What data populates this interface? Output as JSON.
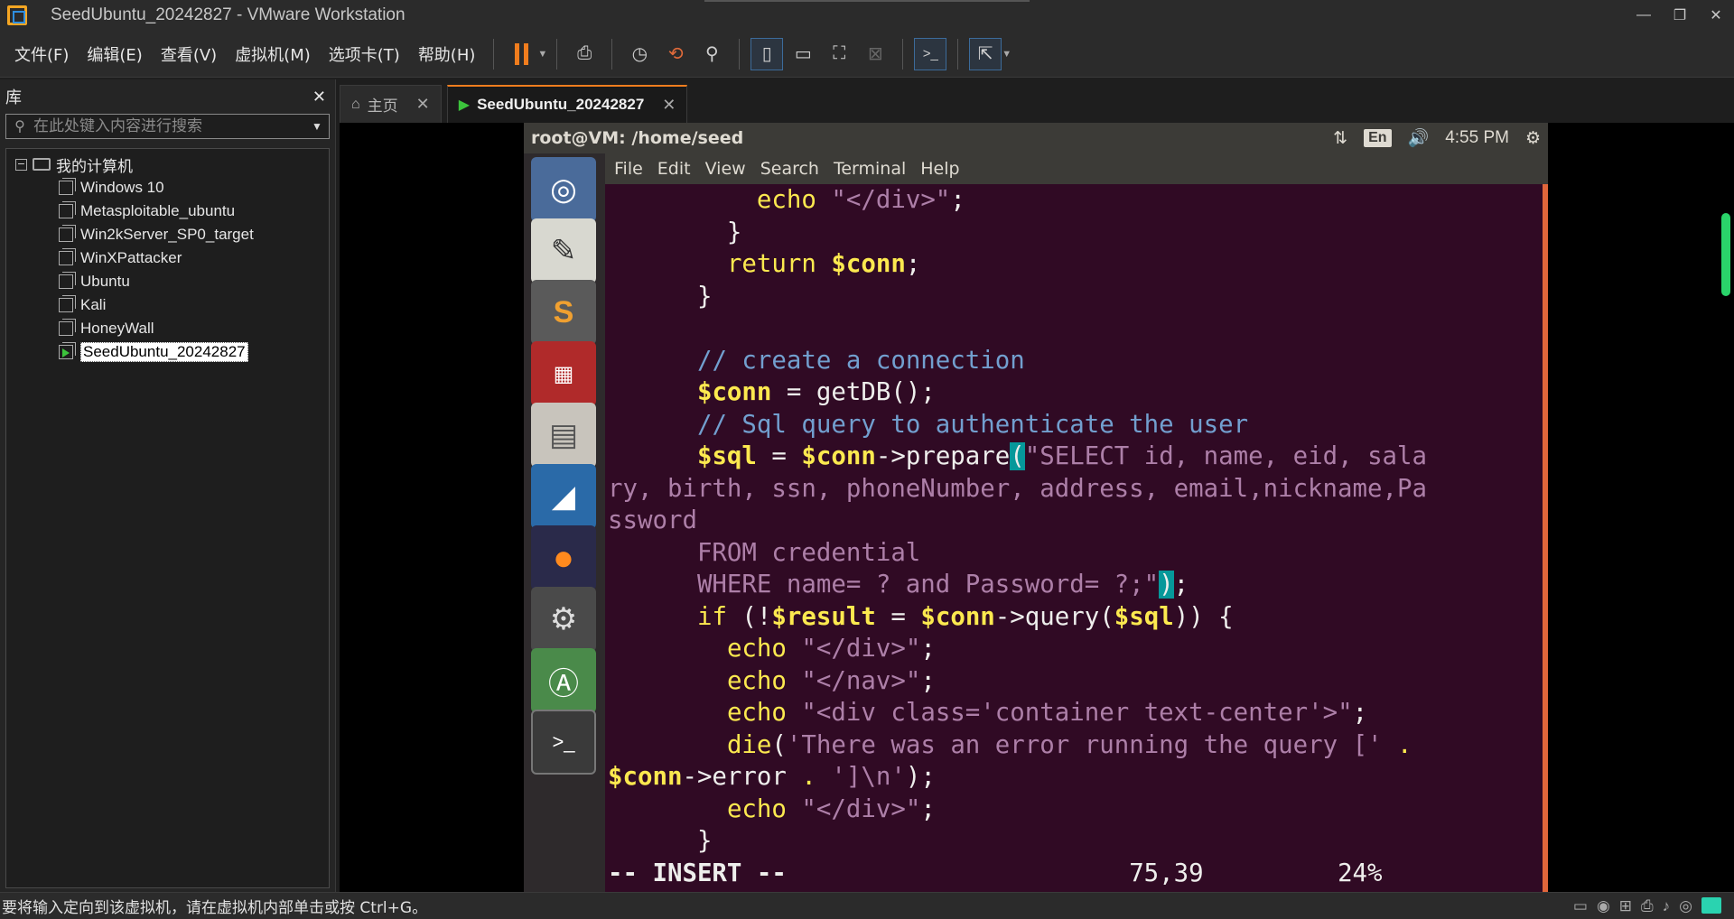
{
  "window": {
    "title": "SeedUbuntu_20242827 - VMware Workstation",
    "controls": [
      "—",
      "❐",
      "✕"
    ]
  },
  "menu": {
    "items": [
      "文件(F)",
      "编辑(E)",
      "查看(V)",
      "虚拟机(M)",
      "选项卡(T)",
      "帮助(H)"
    ]
  },
  "library": {
    "title": "库",
    "search_placeholder": "在此处键入内容进行搜索",
    "root": "我的计算机",
    "vms": [
      "Windows 10",
      "Metasploitable_ubuntu",
      "Win2kServer_SP0_target",
      "WinXPattacker",
      "Ubuntu",
      "Kali",
      "HoneyWall",
      "SeedUbuntu_20242827"
    ]
  },
  "tabs": {
    "home": "主页",
    "vm": "SeedUbuntu_20242827"
  },
  "ubuntu": {
    "window_title": "root@VM: /home/seed",
    "input_lang": "En",
    "clock": "4:55 PM",
    "terminal_menu": [
      "File",
      "Edit",
      "View",
      "Search",
      "Terminal",
      "Help"
    ]
  },
  "vim": {
    "mode": "-- INSERT --",
    "position": "75,39",
    "percent": "24%"
  },
  "colors": {
    "vmware_accent": "#f07d1e",
    "ubuntu_bg": "#300a24",
    "ubuntu_panel": "#3c3b37",
    "status_green": "#2ad36a"
  },
  "statusbar": {
    "text": "要将输入定向到该虚拟机，请在虚拟机内部单击或按 Ctrl+G。"
  }
}
